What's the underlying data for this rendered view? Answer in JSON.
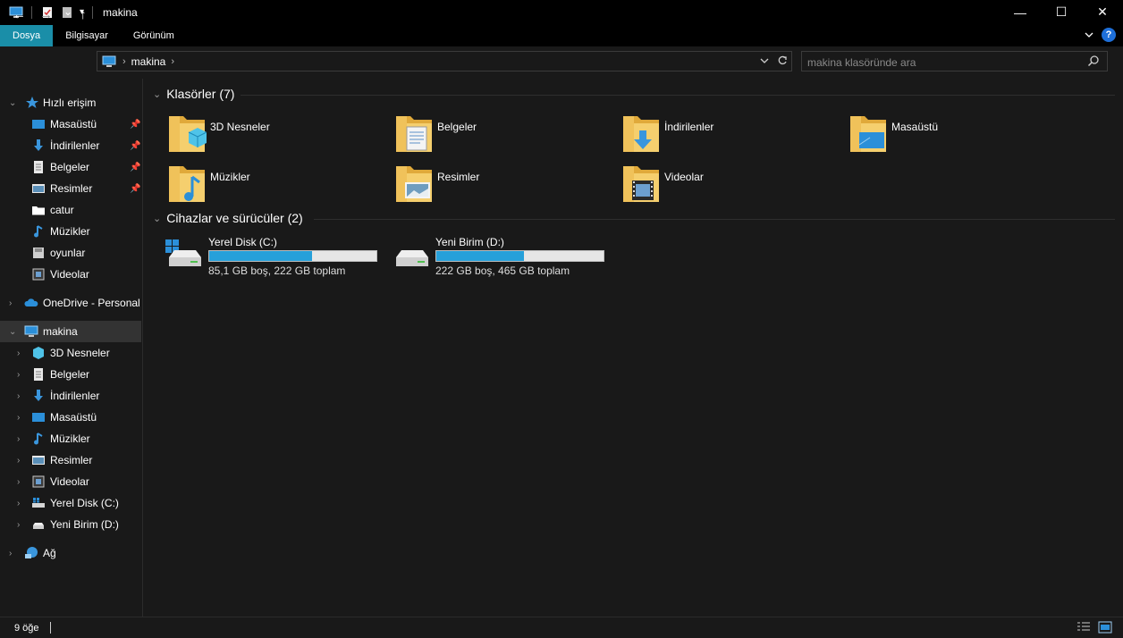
{
  "window": {
    "title": "makina",
    "minimize": "—",
    "maximize": "☐",
    "close": "✕"
  },
  "ribbon": {
    "tabs": [
      {
        "label": "Dosya",
        "active": true
      },
      {
        "label": "Bilgisayar",
        "active": false
      },
      {
        "label": "Görünüm",
        "active": false
      }
    ],
    "expand_icon": "chevron-down-icon",
    "help_label": "?"
  },
  "nav": {
    "back": "←",
    "forward": "→",
    "recent": "⌄",
    "up": "↑"
  },
  "address": {
    "crumbs": [
      "makina"
    ],
    "sep": "›"
  },
  "search": {
    "placeholder": "makina klasöründe ara"
  },
  "sidebar": {
    "quick_access": {
      "label": "Hızlı erişim",
      "items": [
        {
          "label": "Masaüstü",
          "icon": "desktop-icon",
          "pinned": true
        },
        {
          "label": "İndirilenler",
          "icon": "downloads-icon",
          "pinned": true
        },
        {
          "label": "Belgeler",
          "icon": "documents-icon",
          "pinned": true
        },
        {
          "label": "Resimler",
          "icon": "pictures-icon",
          "pinned": true
        },
        {
          "label": "catur",
          "icon": "folder-icon",
          "pinned": false
        },
        {
          "label": "Müzikler",
          "icon": "music-icon",
          "pinned": false
        },
        {
          "label": "oyunlar",
          "icon": "drive-folder-icon",
          "pinned": false
        },
        {
          "label": "Videolar",
          "icon": "videos-icon",
          "pinned": false
        }
      ]
    },
    "onedrive": {
      "label": "OneDrive - Personal"
    },
    "this_pc": {
      "label": "makina",
      "items": [
        {
          "label": "3D Nesneler",
          "icon": "3d-objects-icon"
        },
        {
          "label": "Belgeler",
          "icon": "documents-icon"
        },
        {
          "label": "İndirilenler",
          "icon": "downloads-icon"
        },
        {
          "label": "Masaüstü",
          "icon": "desktop-icon"
        },
        {
          "label": "Müzikler",
          "icon": "music-icon"
        },
        {
          "label": "Resimler",
          "icon": "pictures-icon"
        },
        {
          "label": "Videolar",
          "icon": "videos-icon"
        },
        {
          "label": "Yerel Disk (C:)",
          "icon": "drive-icon"
        },
        {
          "label": "Yeni Birim (D:)",
          "icon": "drive-icon"
        }
      ]
    },
    "network": {
      "label": "Ağ"
    }
  },
  "main": {
    "folders_group": {
      "label": "Klasörler (7)",
      "items": [
        {
          "label": "3D Nesneler",
          "icon": "3d-objects-folder-icon"
        },
        {
          "label": "Belgeler",
          "icon": "documents-folder-icon"
        },
        {
          "label": "İndirilenler",
          "icon": "downloads-folder-icon"
        },
        {
          "label": "Masaüstü",
          "icon": "desktop-folder-icon"
        },
        {
          "label": "Müzikler",
          "icon": "music-folder-icon"
        },
        {
          "label": "Resimler",
          "icon": "pictures-folder-icon"
        },
        {
          "label": "Videolar",
          "icon": "videos-folder-icon"
        }
      ]
    },
    "devices_group": {
      "label": "Cihazlar ve sürücüler (2)",
      "items": [
        {
          "label": "Yerel Disk (C:)",
          "info": "85,1 GB boş, 222 GB toplam",
          "used_fraction": 0.617,
          "icon": "windows-drive-icon"
        },
        {
          "label": "Yeni Birim (D:)",
          "info": "222 GB boş, 465 GB toplam",
          "used_fraction": 0.523,
          "icon": "drive-icon"
        }
      ]
    }
  },
  "status": {
    "count": "9 öğe"
  },
  "colors": {
    "accent": "#1a8ea8",
    "bar_fill": "#26a0da",
    "folder": "#f3c85a",
    "background": "#191919"
  }
}
